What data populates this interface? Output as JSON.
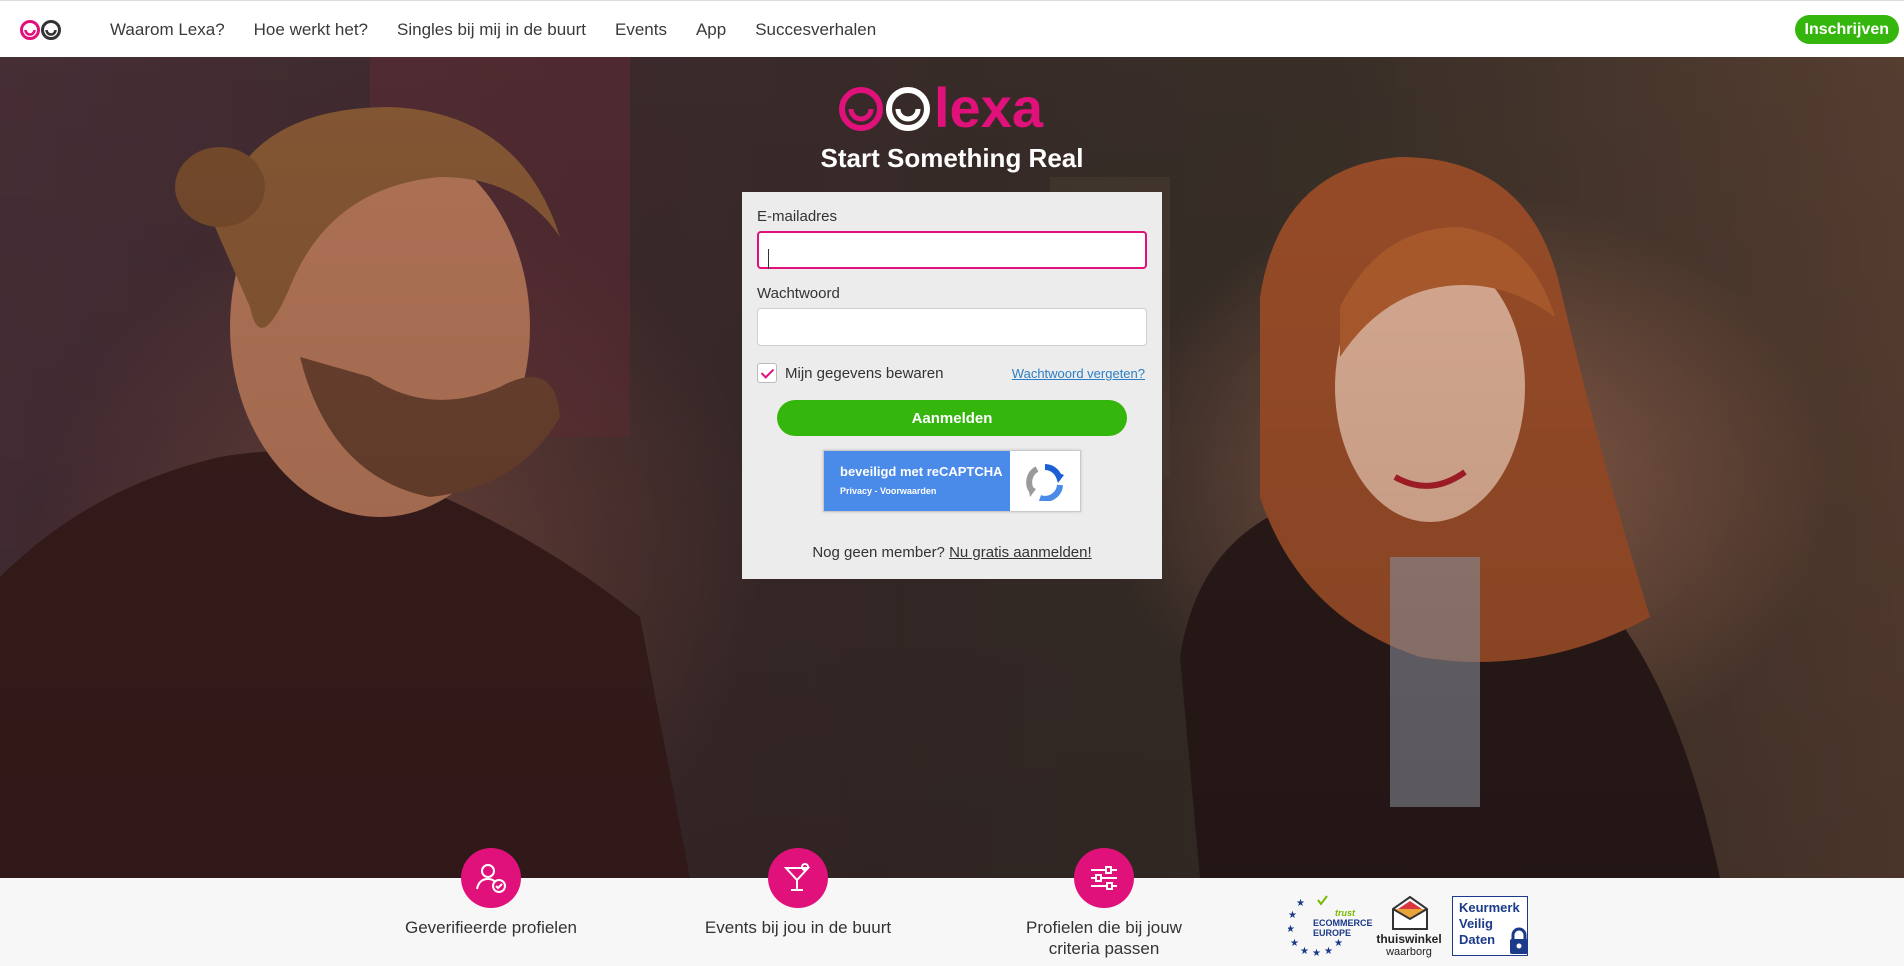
{
  "nav": {
    "items": [
      "Waarom Lexa?",
      "Hoe werkt het?",
      "Singles bij mij in de buurt",
      "Events",
      "App",
      "Succesverhalen"
    ],
    "signup_label": "Inschrijven"
  },
  "hero": {
    "brand": "lexa",
    "tagline": "Start Something Real"
  },
  "login": {
    "email_label": "E-mailadres",
    "email_value": "",
    "password_label": "Wachtwoord",
    "password_value": "",
    "remember_label": "Mijn gegevens bewaren",
    "remember_checked": true,
    "forgot_label": "Wachtwoord vergeten?",
    "submit_label": "Aanmelden",
    "captcha_title": "beveiligd met reCAPTCHA",
    "captcha_links": "Privacy - Voorwaarden",
    "no_member_text": "Nog geen member?",
    "signup_link": "Nu gratis aanmelden!"
  },
  "features": [
    {
      "icon": "verified-user-icon",
      "label": "Geverifieerde profielen"
    },
    {
      "icon": "cocktail-icon",
      "label": "Events bij jou in de buurt"
    },
    {
      "icon": "sliders-icon",
      "label": "Profielen die bij jouw criteria passen"
    }
  ],
  "badges": {
    "ecommerce_trust": "trust",
    "ecommerce_line1": "ECOMMERCE",
    "ecommerce_line2": "EUROPE",
    "thuiswinkel_line1": "thuiswinkel",
    "thuiswinkel_line2": "waarborg",
    "keurmerk_line1": "Keurmerk",
    "keurmerk_line2": "Veilig",
    "keurmerk_line3": "Daten"
  },
  "colors": {
    "brand_pink": "#e0117a",
    "cta_green": "#35b60d",
    "link_blue": "#2c7fc4",
    "captcha_blue": "#4a8ae8"
  }
}
